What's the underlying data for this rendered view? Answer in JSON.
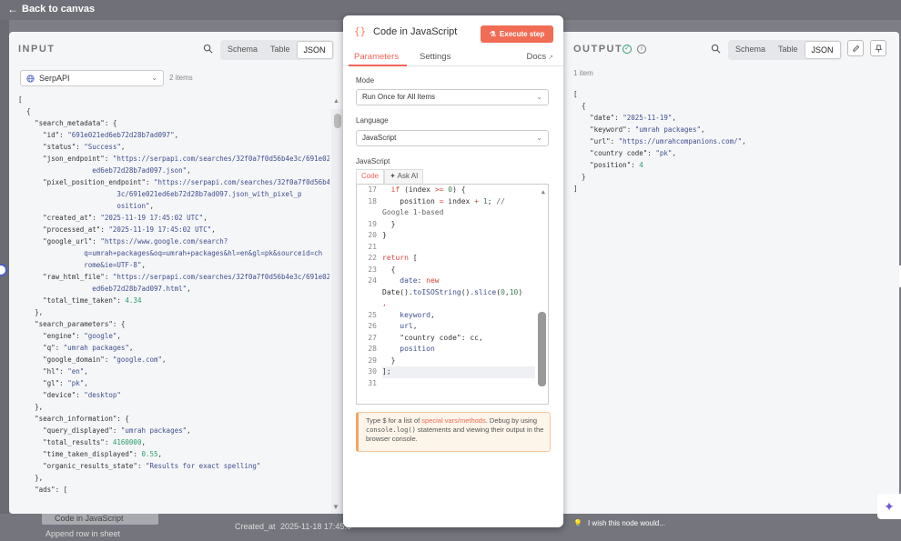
{
  "canvas": {
    "back_label": "Back to canvas",
    "bottom_row_label": "Created_at",
    "bottom_row_date": "2025-11-18 17:45:0",
    "bottom_node_1": "Code in JavaScript",
    "bottom_node_2": "Append row in sheet"
  },
  "input": {
    "title": "INPUT",
    "tabs": [
      "Schema",
      "Table",
      "JSON"
    ],
    "active_tab": "JSON",
    "source": "SerpAPI",
    "items_count": "2 items",
    "json_lines": [
      {
        "indent": 0,
        "text": "["
      },
      {
        "indent": 1,
        "text": "{"
      },
      {
        "indent": 2,
        "key": "\"search_metadata\"",
        "rest": ": {"
      },
      {
        "indent": 3,
        "key": "\"id\"",
        "rest": ": ",
        "str": "\"691e021ed6eb72d28b7ad097\"",
        "end": ","
      },
      {
        "indent": 3,
        "key": "\"status\"",
        "rest": ": ",
        "str": "\"Success\"",
        "end": ","
      },
      {
        "indent": 3,
        "key": "\"json_endpoint\"",
        "rest": ": ",
        "str": "\"https://serpapi.com/searches/32f0a7f0d56b4e3c/691e021",
        "end": ""
      },
      {
        "indent": 9,
        "str": "ed6eb72d28b7ad097.json\"",
        "end": ","
      },
      {
        "indent": 3,
        "key": "\"pixel_position_endpoint\"",
        "rest": ": ",
        "str": "\"https://serpapi.com/searches/32f0a7f0d56b4e",
        "end": ""
      },
      {
        "indent": 12,
        "str": "3c/691e021ed6eb72d28b7ad097.json_with_pixel_p",
        "end": ""
      },
      {
        "indent": 12,
        "str": "osition\"",
        "end": ","
      },
      {
        "indent": 3,
        "key": "\"created_at\"",
        "rest": ": ",
        "str": "\"2025-11-19 17:45:02 UTC\"",
        "end": ","
      },
      {
        "indent": 3,
        "key": "\"processed_at\"",
        "rest": ": ",
        "str": "\"2025-11-19 17:45:02 UTC\"",
        "end": ","
      },
      {
        "indent": 3,
        "key": "\"google_url\"",
        "rest": ": ",
        "str": "\"https://www.google.com/search?",
        "end": ""
      },
      {
        "indent": 8,
        "str": "q=umrah+packages&oq=umrah+packages&hl=en&gl=pk&sourceid=ch",
        "end": ""
      },
      {
        "indent": 8,
        "str": "rome&ie=UTF-8\"",
        "end": ","
      },
      {
        "indent": 3,
        "key": "\"raw_html_file\"",
        "rest": ": ",
        "str": "\"https://serpapi.com/searches/32f0a7f0d56b4e3c/691e021",
        "end": ""
      },
      {
        "indent": 9,
        "str": "ed6eb72d28b7ad097.html\"",
        "end": ","
      },
      {
        "indent": 3,
        "key": "\"total_time_taken\"",
        "rest": ": ",
        "num": "4.34"
      },
      {
        "indent": 2,
        "text": "},"
      },
      {
        "indent": 2,
        "key": "\"search_parameters\"",
        "rest": ": {"
      },
      {
        "indent": 3,
        "key": "\"engine\"",
        "rest": ": ",
        "str": "\"google\"",
        "end": ","
      },
      {
        "indent": 3,
        "key": "\"q\"",
        "rest": ": ",
        "str": "\"umrah packages\"",
        "end": ","
      },
      {
        "indent": 3,
        "key": "\"google_domain\"",
        "rest": ": ",
        "str": "\"google.com\"",
        "end": ","
      },
      {
        "indent": 3,
        "key": "\"hl\"",
        "rest": ": ",
        "str": "\"en\"",
        "end": ","
      },
      {
        "indent": 3,
        "key": "\"gl\"",
        "rest": ": ",
        "str": "\"pk\"",
        "end": ","
      },
      {
        "indent": 3,
        "key": "\"device\"",
        "rest": ": ",
        "str": "\"desktop\"",
        "end": ""
      },
      {
        "indent": 2,
        "text": "},"
      },
      {
        "indent": 2,
        "key": "\"search_information\"",
        "rest": ": {"
      },
      {
        "indent": 3,
        "key": "\"query_displayed\"",
        "rest": ": ",
        "str": "\"umrah packages\"",
        "end": ","
      },
      {
        "indent": 3,
        "key": "\"total_results\"",
        "rest": ": ",
        "num": "4160000",
        "end": ","
      },
      {
        "indent": 3,
        "key": "\"time_taken_displayed\"",
        "rest": ": ",
        "num": "0.55",
        "end": ","
      },
      {
        "indent": 3,
        "key": "\"organic_results_state\"",
        "rest": ": ",
        "str": "\"Results for exact spelling\"",
        "end": ""
      },
      {
        "indent": 2,
        "text": "},"
      },
      {
        "indent": 2,
        "key": "\"ads\"",
        "rest": ": ["
      }
    ]
  },
  "code": {
    "title": "Code in JavaScript",
    "execute_label": "Execute step",
    "tab_parameters": "Parameters",
    "tab_settings": "Settings",
    "docs_label": "Docs",
    "mode_label": "Mode",
    "mode_value": "Run Once for All Items",
    "language_label": "Language",
    "language_value": "JavaScript",
    "editor_label": "JavaScript",
    "editor_tab_code": "Code",
    "editor_tab_ai": "Ask AI",
    "line_numbers": [
      "17",
      "18",
      "",
      "19",
      "20",
      "21",
      "22",
      "23",
      "24",
      "",
      "",
      "25",
      "26",
      "27",
      "28",
      "29",
      "30",
      "31"
    ],
    "hint_prefix": "Type $ for a list of ",
    "hint_link": "special vars/methods",
    "hint_mid": ". Debug by using ",
    "hint_code": "console.log()",
    "hint_suffix": " statements and viewing their output in the browser console."
  },
  "output": {
    "title": "OUTPUT",
    "tabs": [
      "Schema",
      "Table",
      "JSON"
    ],
    "active_tab": "JSON",
    "items_count": "1 item",
    "record": {
      "date": "\"2025-11-19\"",
      "keyword": "\"umrah packages\"",
      "url": "\"https://umrahcompanions.com/\"",
      "country_code": "\"pk\"",
      "position": "4"
    },
    "wish_label": "I wish this node would..."
  },
  "colors": {
    "accent": "#f16c55",
    "success": "#2a9d6b",
    "string": "#3f4f8f"
  }
}
